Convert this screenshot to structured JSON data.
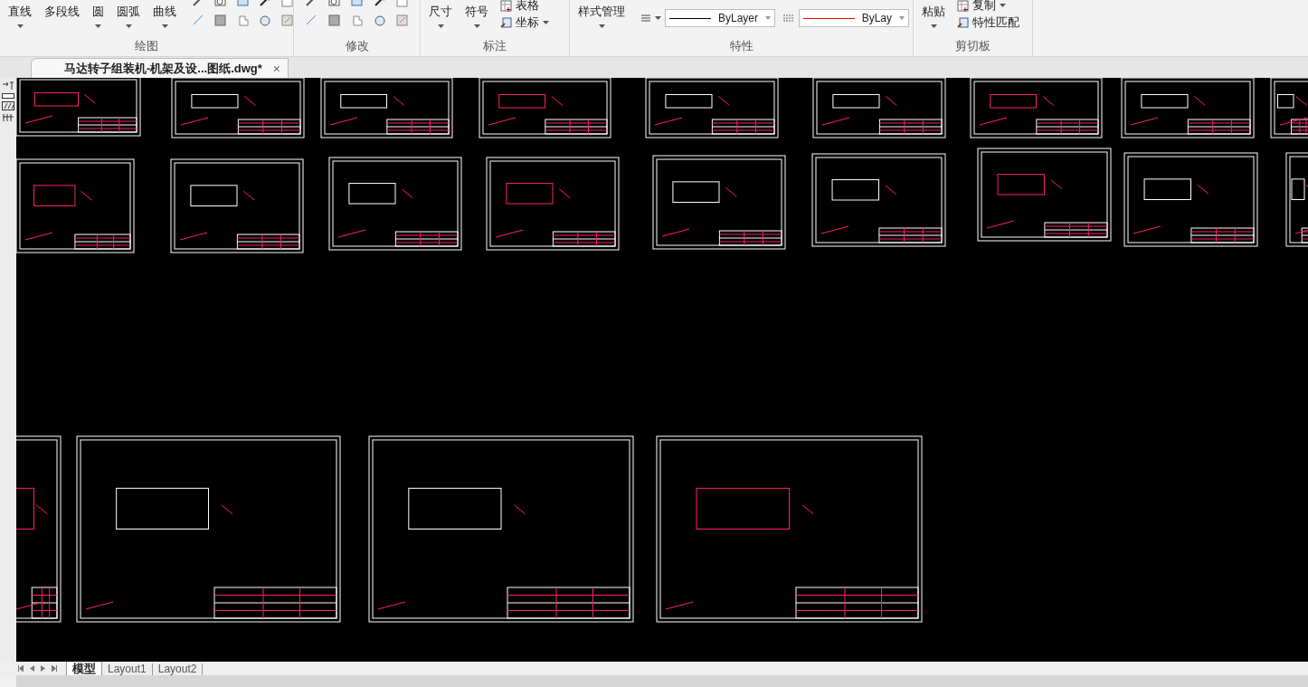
{
  "ribbon": [
    {
      "title": "绘图",
      "items": [
        {
          "kind": "big",
          "label": "直线",
          "caret": true
        },
        {
          "kind": "big",
          "label": "多段线",
          "caret": false
        },
        {
          "kind": "big",
          "label": "圆",
          "caret": true
        },
        {
          "kind": "big",
          "label": "圆弧",
          "caret": true
        },
        {
          "kind": "big",
          "label": "曲线",
          "caret": true
        },
        {
          "kind": "icon_grid"
        }
      ]
    },
    {
      "title": "修改",
      "items": [
        {
          "kind": "icon_grid"
        }
      ]
    },
    {
      "title": "标注",
      "items": [
        {
          "kind": "big",
          "label": "尺寸",
          "caret": true
        },
        {
          "kind": "big",
          "label": "符号",
          "caret": true
        },
        {
          "kind": "small_pair",
          "top": {
            "label": "表格",
            "caret": false
          },
          "bottom": {
            "label": "坐标",
            "caret": true
          }
        }
      ]
    },
    {
      "title": "特性",
      "items": [
        {
          "kind": "big",
          "label": "样式管理",
          "caret": true
        },
        {
          "kind": "dropdown",
          "value": "ByLayer",
          "color": "#000000"
        },
        {
          "kind": "dropdown",
          "value": "ByLay",
          "color": "#ff0000"
        }
      ]
    },
    {
      "title": "剪切板",
      "items": [
        {
          "kind": "big",
          "label": "粘贴",
          "caret": true
        },
        {
          "kind": "small_pair",
          "top": {
            "label": "复制",
            "caret": true
          },
          "bottom": {
            "label": "特性匹配",
            "caret": false
          }
        }
      ]
    }
  ],
  "document_tab": {
    "title": "马达转子组装机-机架及设...图纸.dwg*",
    "close": "×"
  },
  "layout_tabs": [
    {
      "label": "模型",
      "selected": true
    },
    {
      "label": "Layout1",
      "selected": false
    },
    {
      "label": "Layout2",
      "selected": false
    }
  ]
}
